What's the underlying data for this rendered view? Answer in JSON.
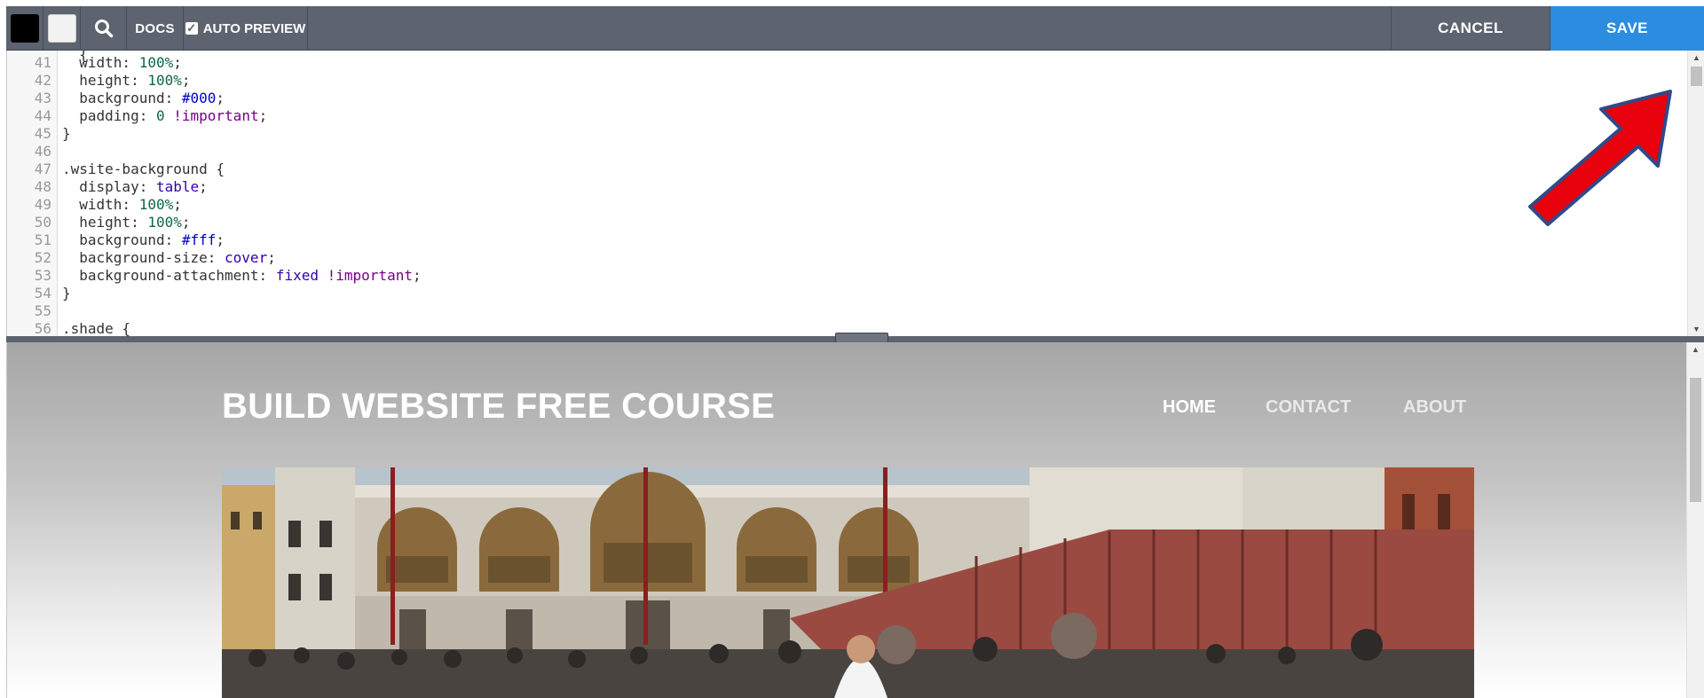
{
  "toolbar": {
    "swatch_black_icon": "black-swatch-icon",
    "swatch_white_icon": "white-swatch-icon",
    "search_icon": "search-icon",
    "docs_label": "DOCS",
    "auto_preview_label": "AUTO PREVIEW",
    "auto_preview_checked": true,
    "cancel_label": "CANCEL",
    "save_label": "SAVE"
  },
  "editor": {
    "lines": [
      {
        "n": "41",
        "text": "  width: 100%;"
      },
      {
        "n": "42",
        "text": "  height: 100%;"
      },
      {
        "n": "43",
        "text": "  background: #000;"
      },
      {
        "n": "44",
        "text": "  padding: 0 !important;"
      },
      {
        "n": "45",
        "text": "}"
      },
      {
        "n": "46",
        "text": ""
      },
      {
        "n": "47",
        "text": ".wsite-background {"
      },
      {
        "n": "48",
        "text": "  display: table;"
      },
      {
        "n": "49",
        "text": "  width: 100%;"
      },
      {
        "n": "50",
        "text": "  height: 100%;"
      },
      {
        "n": "51",
        "text": "  background: #fff;"
      },
      {
        "n": "52",
        "text": "  background-size: cover;"
      },
      {
        "n": "53",
        "text": "  background-attachment: fixed !important;"
      },
      {
        "n": "54",
        "text": "}"
      },
      {
        "n": "55",
        "text": ""
      },
      {
        "n": "56",
        "text": ".shade {"
      }
    ]
  },
  "preview": {
    "site_title": "BUILD WEBSITE FREE COURSE",
    "nav": [
      {
        "label": "HOME",
        "active": true
      },
      {
        "label": "CONTACT",
        "active": false
      },
      {
        "label": "ABOUT",
        "active": false
      }
    ],
    "hero_icon": "hero-photo"
  },
  "colors": {
    "toolbar_bg": "#5d6470",
    "save_bg": "#2b8ce0",
    "annotation_arrow": "#e8000d"
  }
}
